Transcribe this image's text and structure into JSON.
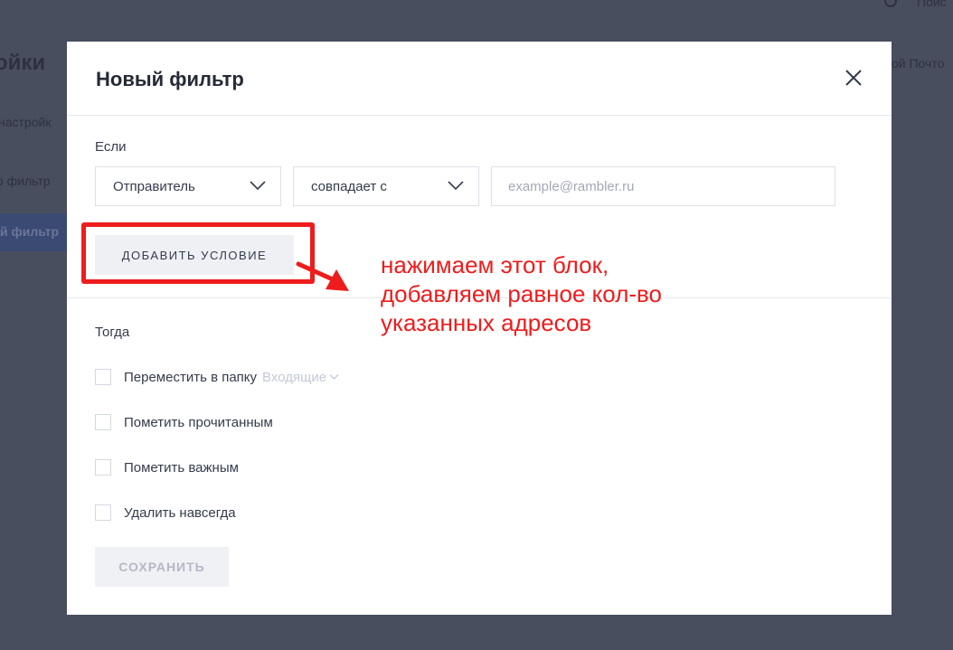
{
  "background": {
    "page_title": "ойки",
    "settings_link": "настройк",
    "filters_link": "о фильтр",
    "create_filter_button": "й фильтр",
    "search_label": "Поис",
    "mail_label": "ой Почто"
  },
  "modal": {
    "title": "Новый фильтр",
    "if_label": "Если",
    "condition": {
      "field_select": "Отправитель",
      "operator_select": "совпадает с",
      "value_placeholder": "example@rambler.ru"
    },
    "add_condition_label": "ДОБАВИТЬ УСЛОВИЕ",
    "then_label": "Тогда",
    "actions": [
      {
        "label": "Переместить в папку",
        "checked": false,
        "folder": "Входящие"
      },
      {
        "label": "Пометить прочитанным",
        "checked": false
      },
      {
        "label": "Пометить важным",
        "checked": false
      },
      {
        "label": "Удалить навсегда",
        "checked": false
      }
    ],
    "save_label": "СОХРАНИТЬ"
  },
  "annotation": {
    "text_line_1": "нажимаем этот блок,",
    "text_line_2": "добавляем равное кол-во",
    "text_line_3": "указанных адресов",
    "color": "#ee1c1c"
  },
  "colors": {
    "overlay": "#494e5e",
    "modal_bg": "#ffffff",
    "button_bg": "#eff0f4",
    "border": "#dde0e7"
  }
}
